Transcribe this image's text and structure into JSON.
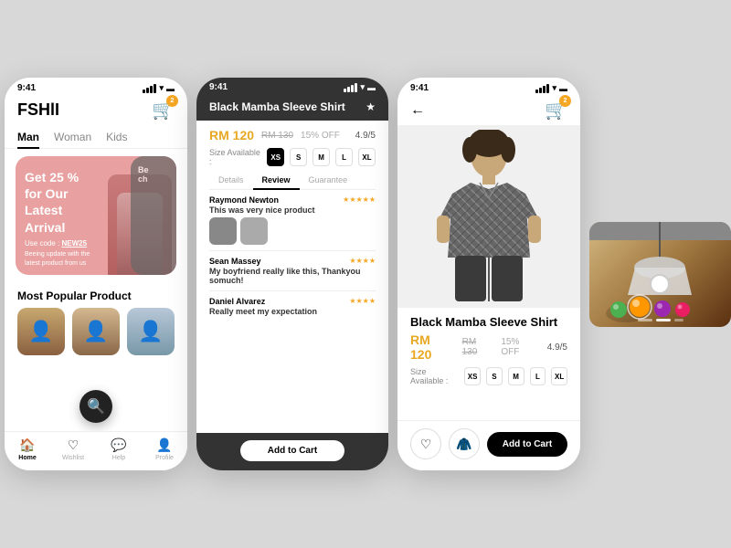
{
  "app": {
    "logo": "FSHlI",
    "status_time": "9:41",
    "cart_badge": "2"
  },
  "phone1": {
    "tabs": [
      "Man",
      "Woman",
      "Kids"
    ],
    "active_tab": "Man",
    "promo": {
      "title": "Get 25 % for Our Latest Arrival",
      "code_label": "Use code :",
      "code": "NEW25",
      "desc": "Beeing update with the latest product from us"
    },
    "section_popular": "Most Popular Product",
    "nav": [
      {
        "label": "Home",
        "icon": "🏠",
        "active": true
      },
      {
        "label": "Wishlist",
        "icon": "♡",
        "active": false
      },
      {
        "label": "Help",
        "icon": "💬",
        "active": false
      },
      {
        "label": "Profile",
        "icon": "👤",
        "active": false
      }
    ]
  },
  "phone2": {
    "status_time": "9:41",
    "product_name": "Black Mamba Sleeve Shirt",
    "price_main": "RM 120",
    "price_old": "RM 130",
    "discount": "15% OFF",
    "rating": "4.9/5",
    "sizes": [
      "XS",
      "S",
      "M",
      "L",
      "XL"
    ],
    "active_size": "XS",
    "tabs": [
      "Details",
      "Review",
      "Guarantee"
    ],
    "active_tab": "Review",
    "reviews": [
      {
        "author": "Raymond Newton",
        "stars": "★★★★★",
        "text": "This was very nice product",
        "has_imgs": true
      },
      {
        "author": "Sean Massey",
        "stars": "★★★★",
        "text": "My boyfriend really like this, Thankyou somuch!"
      },
      {
        "author": "Daniel Alvarez",
        "stars": "★★★★",
        "text": "Really meet my expectation"
      }
    ],
    "add_to_cart": "Add to Cart"
  },
  "phone3": {
    "status_time": "9:41",
    "product_name": "Black Mamba Sleeve Shirt",
    "price_main": "RM 120",
    "price_old": "RM 130",
    "discount": "15% OFF",
    "rating": "4.9/5",
    "sizes": [
      "XS",
      "S",
      "M",
      "L",
      "XL"
    ],
    "size_label": "Size Available :",
    "add_to_cart": "Add to Cart"
  },
  "scene": {
    "balls": [
      {
        "color": "#4caf50"
      },
      {
        "color": "#ff9800"
      },
      {
        "color": "#9c27b0"
      },
      {
        "color": "#e91e63"
      }
    ]
  }
}
